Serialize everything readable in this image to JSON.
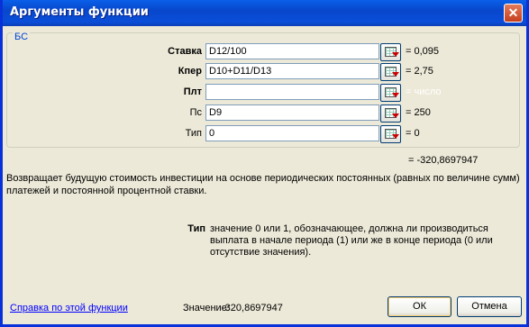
{
  "window": {
    "title": "Аргументы функции",
    "close_glyph": "✕"
  },
  "group": {
    "legend": "БС",
    "args": [
      {
        "label": "Ставка",
        "value": "D12/100",
        "result": "= 0,095",
        "bold": true
      },
      {
        "label": "Кпер",
        "value": "D10+D11/D13",
        "result": "= 2,75",
        "bold": true
      },
      {
        "label": "Плт",
        "value": "",
        "result": "= число",
        "bold": true
      },
      {
        "label": "Пс",
        "value": "D9",
        "result": "= 250",
        "bold": false
      },
      {
        "label": "Тип",
        "value": "0",
        "result": "= 0",
        "bold": false
      }
    ]
  },
  "formula_result": "= -320,8697947",
  "description": "Возвращает будущую стоимость инвестиции на основе периодических постоянных (равных по величине сумм) платежей и постоянной процентной ставки.",
  "param": {
    "name": "Тип",
    "text": "значение 0 или 1, обозначающее, должна ли производиться выплата в начале периода (1) или же в конце периода (0 или отсутствие значения)."
  },
  "footer": {
    "help_link": "Справка по этой функции",
    "value_label": "Значение:",
    "value": "-320,8697947",
    "ok_label": "ОК",
    "cancel_label": "Отмена"
  },
  "icons": {
    "ref_button": "collapse-dialog-icon"
  },
  "colors": {
    "title_bar": "#0a4ed8",
    "dialog_bg": "#ece9d8",
    "link": "#0000ff",
    "legend": "#0046d5"
  }
}
